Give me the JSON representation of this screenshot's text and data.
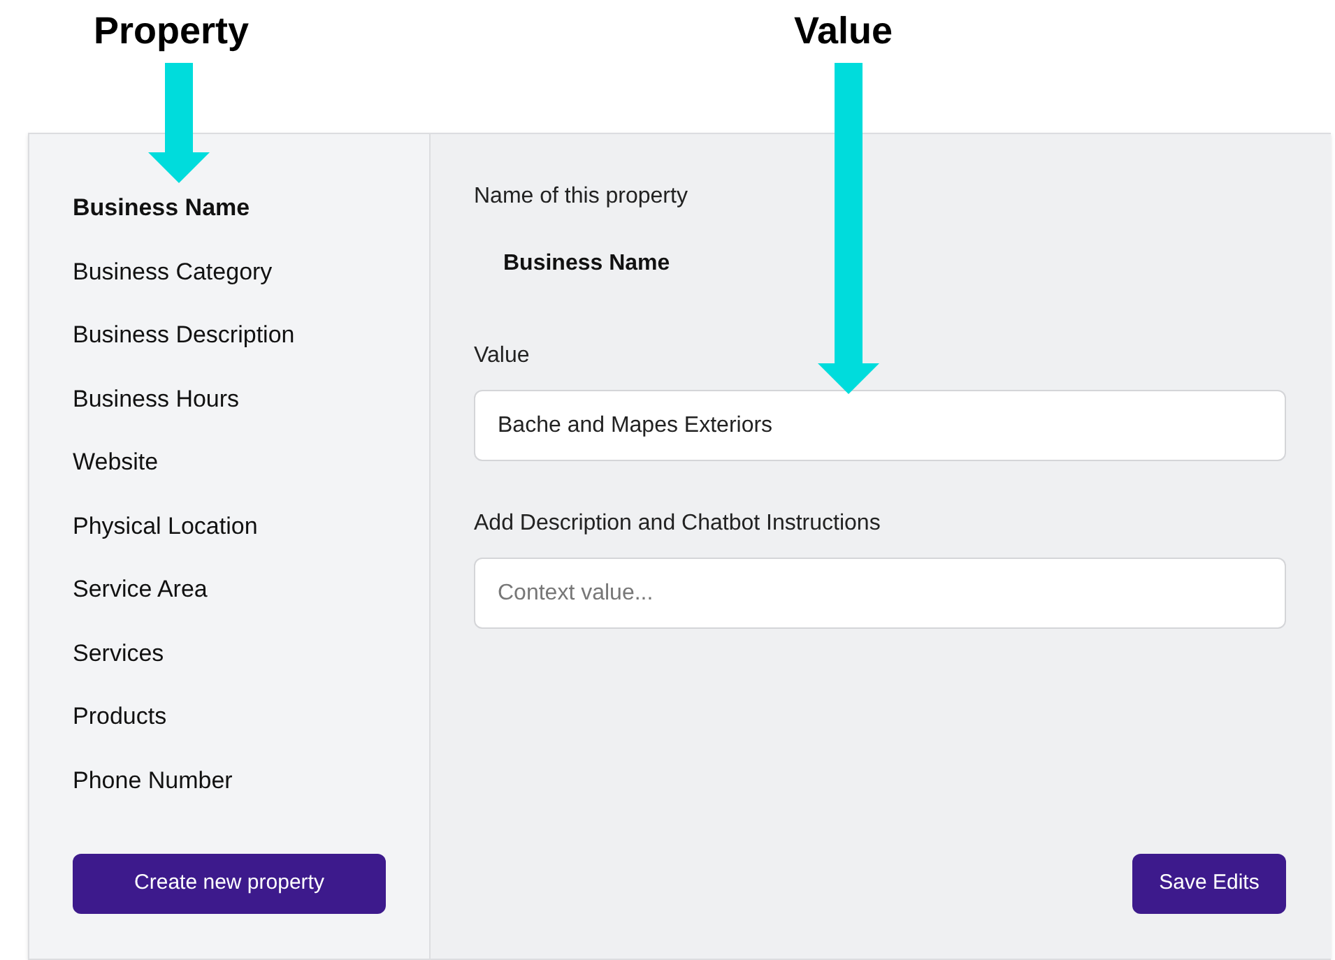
{
  "annotations": [
    {
      "label": "Property"
    },
    {
      "label": "Value"
    }
  ],
  "sidebar": {
    "items": [
      {
        "label": "Business Name",
        "selected": true
      },
      {
        "label": "Business Category",
        "selected": false
      },
      {
        "label": "Business Description",
        "selected": false
      },
      {
        "label": "Business Hours",
        "selected": false
      },
      {
        "label": "Website",
        "selected": false
      },
      {
        "label": "Physical Location",
        "selected": false
      },
      {
        "label": "Service Area",
        "selected": false
      },
      {
        "label": "Services",
        "selected": false
      },
      {
        "label": "Products",
        "selected": false
      },
      {
        "label": "Phone Number",
        "selected": false
      }
    ],
    "button": "Create new property"
  },
  "editor": {
    "name_label": "Name of this property",
    "name": "Business Name",
    "value_label": "Value",
    "value": "Bache and Mapes Exteriors",
    "context_label": "Add Description and Chatbot Instructions",
    "context_placeholder": "Context value...",
    "button": "Save Edits"
  }
}
